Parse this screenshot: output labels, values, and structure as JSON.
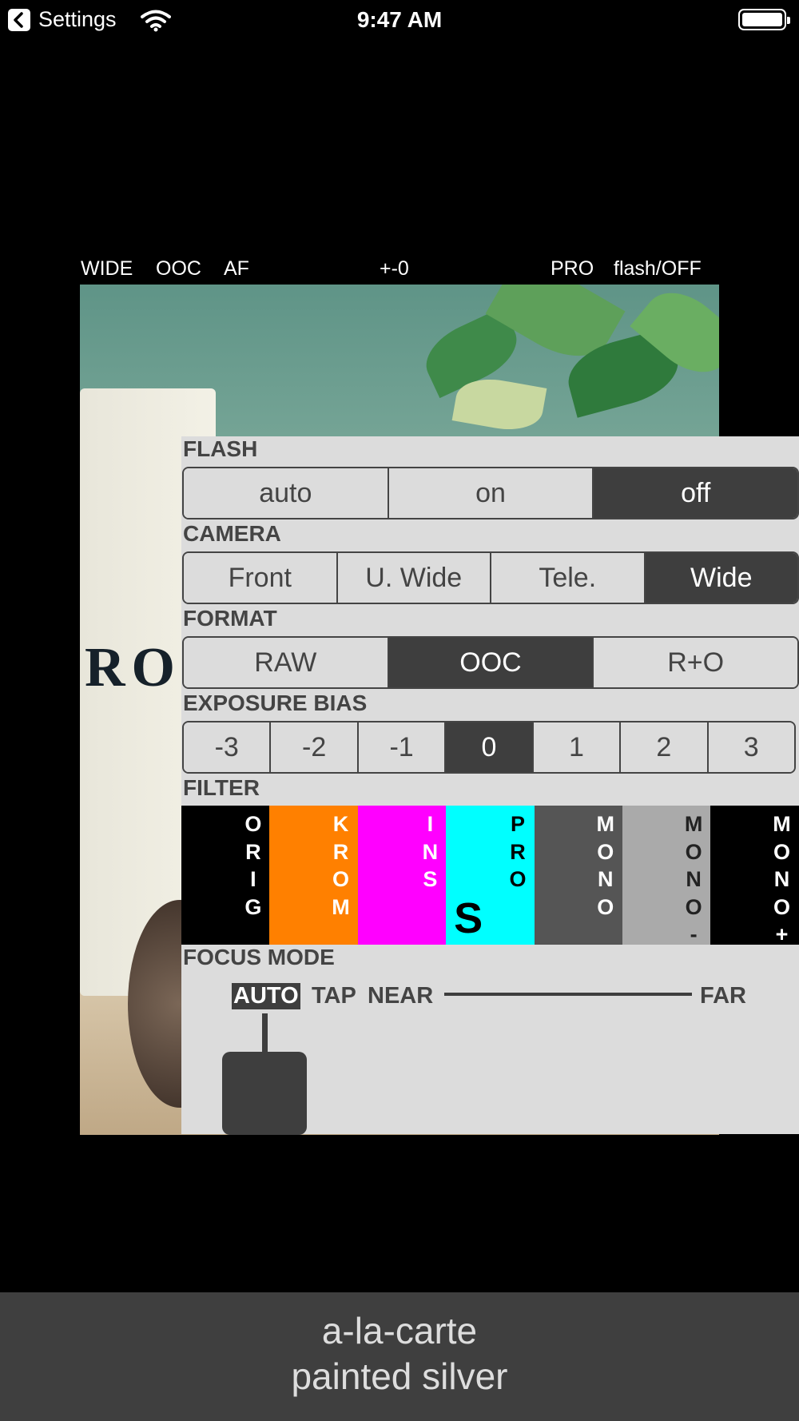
{
  "status_bar": {
    "back_app": "Settings",
    "time": "9:47 AM"
  },
  "camera_info": {
    "lens": "WIDE",
    "format": "OOC",
    "focus": "AF",
    "exposure": "+-0",
    "filter": "PRO",
    "flash": "flash/OFF"
  },
  "preview": {
    "sign_text": "RON"
  },
  "flash": {
    "title": "FLASH",
    "options": [
      "auto",
      "on",
      "off"
    ],
    "selected": "off"
  },
  "camera": {
    "title": "CAMERA",
    "options": [
      "Front",
      "U. Wide",
      "Tele.",
      "Wide"
    ],
    "selected": "Wide"
  },
  "format": {
    "title": "FORMAT",
    "options": [
      "RAW",
      "OOC",
      "R+O"
    ],
    "selected": "OOC"
  },
  "exposure_bias": {
    "title": "EXPOSURE BIAS",
    "options": [
      "-3",
      "-2",
      "-1",
      "0",
      "1",
      "2",
      "3"
    ],
    "selected": "0"
  },
  "filter": {
    "title": "FILTER",
    "options": [
      {
        "label": "ORIG",
        "letters": [
          "O",
          "R",
          "I",
          "G"
        ],
        "bg": "#000000",
        "fg": "#ffffff"
      },
      {
        "label": "KROM",
        "letters": [
          "K",
          "R",
          "O",
          "M"
        ],
        "bg": "#ff8000",
        "fg": "#ffffff"
      },
      {
        "label": "INS",
        "letters": [
          "I",
          "N",
          "S"
        ],
        "bg": "#ff00ff",
        "fg": "#ffffff"
      },
      {
        "label": "PRO",
        "letters": [
          "P",
          "R",
          "O"
        ],
        "bg": "#00ffff",
        "fg": "#000000",
        "selected_mark": "S"
      },
      {
        "label": "MONO",
        "letters": [
          "M",
          "O",
          "N",
          "O"
        ],
        "bg": "#555555",
        "fg": "#ffffff"
      },
      {
        "label": "MONO-",
        "letters": [
          "M",
          "O",
          "N",
          "O",
          "-"
        ],
        "bg": "#aaaaaa",
        "fg": "#222222"
      },
      {
        "label": "MONO+",
        "letters": [
          "M",
          "O",
          "N",
          "O",
          "+"
        ],
        "bg": "#000000",
        "fg": "#ffffff"
      }
    ]
  },
  "focus_mode": {
    "title": "FOCUS MODE",
    "auto": "AUTO",
    "tap": "TAP",
    "near": "NEAR",
    "far": "FAR",
    "selected": "AUTO"
  },
  "banner": {
    "line1": "a-la-carte",
    "line2": "painted silver"
  },
  "colors": {
    "panel_bg": "#dcdcdc",
    "dark": "#3e3e3e",
    "banner_bg": "#3f3f3f"
  }
}
